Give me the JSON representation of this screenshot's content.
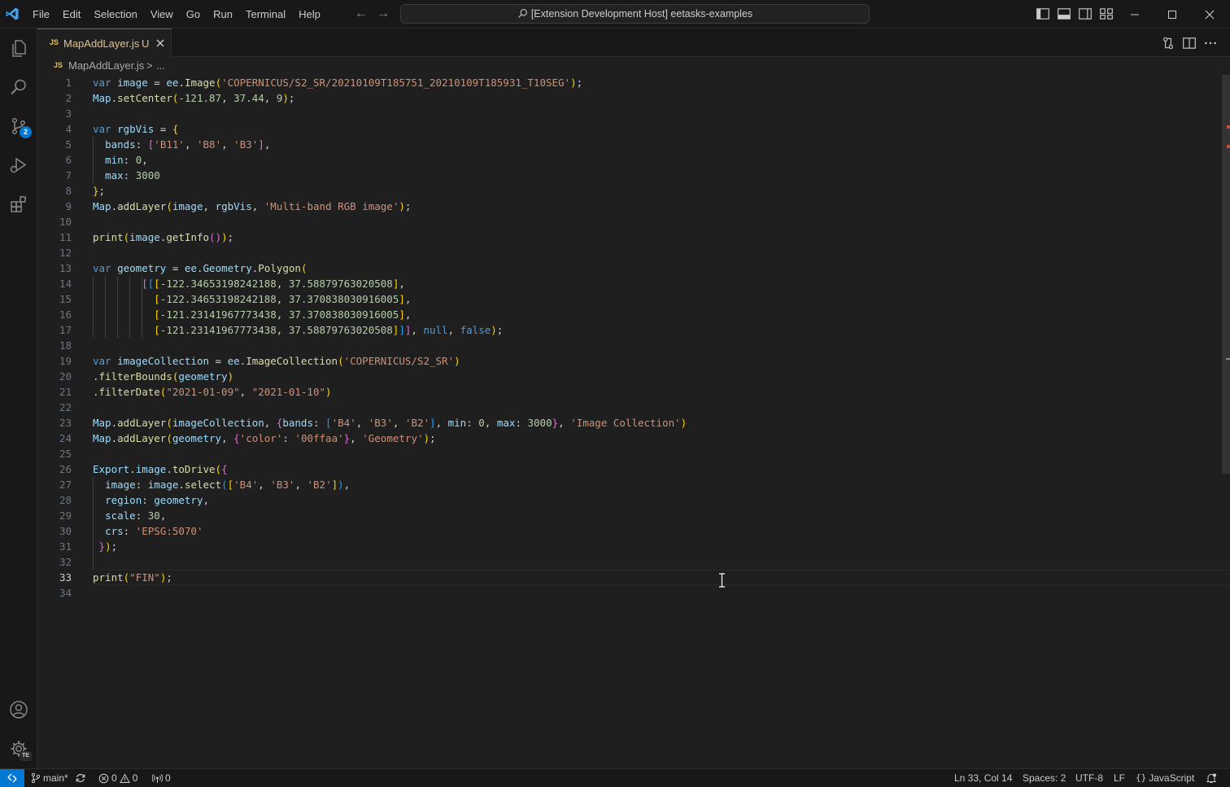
{
  "window": {
    "title": "[Extension Development Host] eetasks-examples",
    "menu": [
      "File",
      "Edit",
      "Selection",
      "View",
      "Go",
      "Run",
      "Terminal",
      "Help"
    ]
  },
  "activity_bar": {
    "items": [
      "explorer-icon",
      "search-icon",
      "source-control-icon",
      "run-debug-icon",
      "extensions-icon"
    ],
    "scm_badge": "2",
    "bottom": [
      "accounts-icon",
      "manage-icon"
    ],
    "profile_badge": "TE"
  },
  "tabs": [
    {
      "label": "MapAddLayer.js",
      "badge": "JS",
      "status": "U",
      "active": true
    }
  ],
  "breadcrumb": {
    "badge": "JS",
    "file": "MapAddLayer.js",
    "separator": ">",
    "more": "..."
  },
  "editor": {
    "language": "JavaScript",
    "current_line": 33,
    "line_numbers": [
      "1",
      "2",
      "3",
      "4",
      "5",
      "6",
      "7",
      "8",
      "9",
      "10",
      "11",
      "12",
      "13",
      "14",
      "15",
      "16",
      "17",
      "18",
      "19",
      "20",
      "21",
      "22",
      "23",
      "24",
      "25",
      "26",
      "27",
      "28",
      "29",
      "30",
      "31",
      "32",
      "33",
      "34"
    ],
    "lines": [
      "var image = ee.Image('COPERNICUS/S2_SR/20210109T185751_20210109T185931_T10SEG');",
      "Map.setCenter(-121.87, 37.44, 9);",
      "",
      "var rgbVis = {",
      "  bands: ['B11', 'B8', 'B3'],",
      "  min: 0,",
      "  max: 3000",
      "};",
      "Map.addLayer(image, rgbVis, 'Multi-band RGB image');",
      "",
      "print(image.getInfo());",
      "",
      "var geometry = ee.Geometry.Polygon(",
      "        [[[-122.34653198242188, 37.58879763020508],",
      "          [-122.34653198242188, 37.370838030916005],",
      "          [-121.23141967773438, 37.370838030916005],",
      "          [-121.23141967773438, 37.58879763020508]]], null, false);",
      "",
      "var imageCollection = ee.ImageCollection('COPERNICUS/S2_SR')",
      ".filterBounds(geometry)",
      ".filterDate(\"2021-01-09\", \"2021-01-10\")",
      "",
      "Map.addLayer(imageCollection, {bands: ['B4', 'B3', 'B2'], min: 0, max: 3000}, 'Image Collection')",
      "Map.addLayer(geometry, {'color': '00ffaa'}, 'Geometry');",
      "",
      "Export.image.toDrive({",
      "  image: image.select(['B4', 'B3', 'B2']),",
      "  region: geometry,",
      "  scale: 30,",
      "  crs: 'EPSG:5070'",
      " });",
      "",
      "print(\"FIN\");",
      ""
    ]
  },
  "status_bar": {
    "branch": "main*",
    "errors": "0",
    "warnings": "0",
    "ports": "0",
    "position": "Ln 33, Col 14",
    "indent": "Spaces: 2",
    "encoding": "UTF-8",
    "eol": "LF",
    "language": "JavaScript"
  },
  "colors": {
    "accent": "#0078d4",
    "modified_file": "#e2c08d",
    "js_badge": "#e8c44c",
    "keyword": "#569cd6",
    "variable": "#9cdcfe",
    "function": "#dcdcaa",
    "string": "#ce9178",
    "number": "#b5cea8"
  }
}
